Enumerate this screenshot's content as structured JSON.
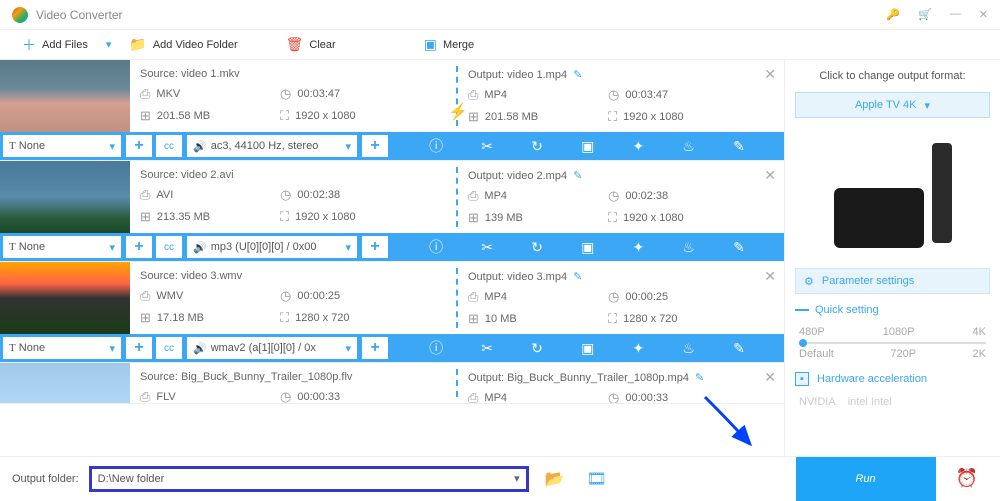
{
  "app": {
    "title": "Video Converter"
  },
  "toolbar": {
    "add_files": "Add Files",
    "add_folder": "Add Video Folder",
    "clear": "Clear",
    "merge": "Merge"
  },
  "subtitle_none": "None",
  "items": [
    {
      "source_label": "Source: video 1.mkv",
      "src_fmt": "MKV",
      "src_dur": "00:03:47",
      "src_size": "201.58 MB",
      "src_res": "1920 x 1080",
      "output_label": "Output: video 1.mp4",
      "out_fmt": "MP4",
      "out_dur": "00:03:47",
      "out_size": "201.58 MB",
      "out_res": "1920 x 1080",
      "audio": "ac3, 44100 Hz, stereo",
      "bolt": true
    },
    {
      "source_label": "Source: video 2.avi",
      "src_fmt": "AVI",
      "src_dur": "00:02:38",
      "src_size": "213.35 MB",
      "src_res": "1920 x 1080",
      "output_label": "Output: video 2.mp4",
      "out_fmt": "MP4",
      "out_dur": "00:02:38",
      "out_size": "139 MB",
      "out_res": "1920 x 1080",
      "audio": "mp3 (U[0][0][0] / 0x00"
    },
    {
      "source_label": "Source: video 3.wmv",
      "src_fmt": "WMV",
      "src_dur": "00:00:25",
      "src_size": "17.18 MB",
      "src_res": "1280 x 720",
      "output_label": "Output: video 3.mp4",
      "out_fmt": "MP4",
      "out_dur": "00:00:25",
      "out_size": "10 MB",
      "out_res": "1280 x 720",
      "audio": "wmav2 (a[1][0][0] / 0x"
    },
    {
      "source_label": "Source: Big_Buck_Bunny_Trailer_1080p.flv",
      "src_fmt": "FLV",
      "src_dur": "00:00:33",
      "output_label": "Output: Big_Buck_Bunny_Trailer_1080p.mp4",
      "out_fmt": "MP4",
      "out_dur": "00:00:33"
    }
  ],
  "sidebar": {
    "hint": "Click to change output format:",
    "format": "Apple TV 4K",
    "param": "Parameter settings",
    "quick": "Quick setting",
    "res_top": [
      "480P",
      "1080P",
      "4K"
    ],
    "res_bottom": [
      "Default",
      "720P",
      "2K"
    ],
    "hw": "Hardware acceleration",
    "vendors": [
      "NVIDIA",
      "intel Intel"
    ]
  },
  "bottom": {
    "label": "Output folder:",
    "path": "D:\\New folder",
    "run": "Run"
  }
}
